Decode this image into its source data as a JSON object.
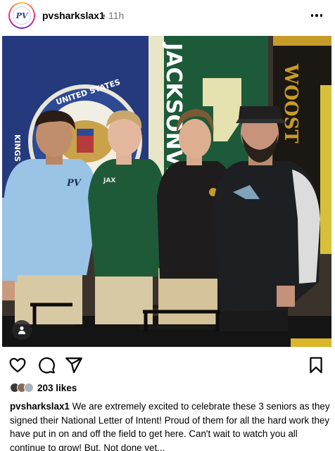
{
  "post": {
    "username": "pvsharkslax1",
    "separator": "•",
    "time": "11h",
    "avatar_text": "PV",
    "likes": "203 likes",
    "caption_user": "pvsharkslax1",
    "caption_text": "We are extremely excited to celebrate these 3 seniors as they signed their National Letter of Intent! Proud of them for all the hard work they have put in on and off the field to get here. Can't wait to watch you all continue to grow! But. Not done yet..."
  },
  "photo": {
    "flag_seal_text": "UNITED STATES",
    "flag_side_text": "KINGS",
    "banner_jacksonville": "JACKSONVI",
    "banner_wooster": "WOOST",
    "shirt_logo_1": "PV",
    "shirt_logo_2": "JAX"
  },
  "icons": {
    "more": "more-options-icon",
    "tag": "user-tag-icon",
    "like": "heart-icon",
    "comment": "comment-icon",
    "share": "share-icon",
    "save": "bookmark-icon"
  },
  "colors": {
    "flag_blue": "#243a7c",
    "banner_green": "#1c5a3a",
    "banner_gold": "#c69b29",
    "muted_text": "#737373"
  }
}
